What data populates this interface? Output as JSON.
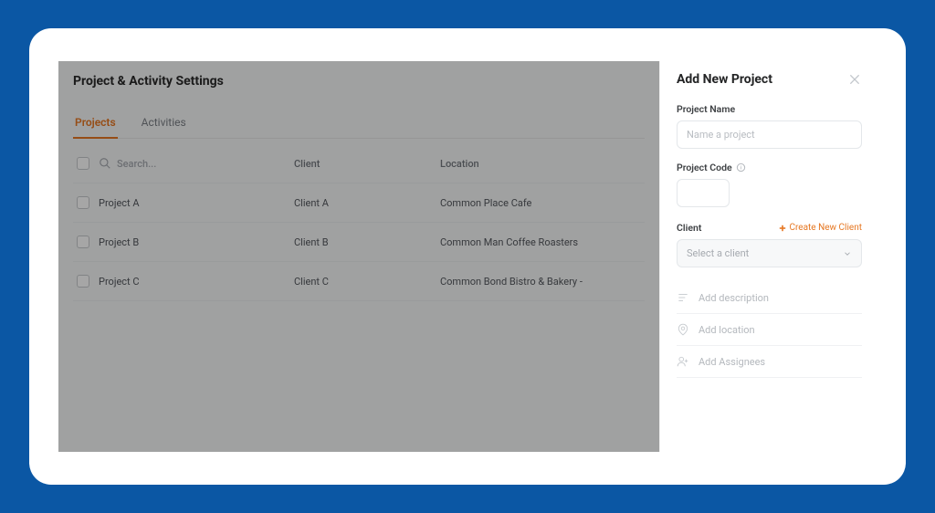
{
  "page": {
    "title": "Project & Activity Settings"
  },
  "tabs": {
    "projects": "Projects",
    "activities": "Activities"
  },
  "table": {
    "search_placeholder": "Search...",
    "col_client": "Client",
    "col_location": "Location",
    "rows": [
      {
        "name": "Project A",
        "client": "Client A",
        "location": "Common Place Cafe"
      },
      {
        "name": "Project B",
        "client": "Client B",
        "location": "Common Man Coffee Roasters"
      },
      {
        "name": "Project C",
        "client": "Client C",
        "location": "Common Bond Bistro & Bakery - "
      }
    ]
  },
  "panel": {
    "title": "Add New Project",
    "project_name_label": "Project Name",
    "project_name_placeholder": "Name a project",
    "project_code_label": "Project Code",
    "client_label": "Client",
    "create_client_label": "Create New Client",
    "select_client_placeholder": "Select a client",
    "add_description": "Add description",
    "add_location": "Add location",
    "add_assignees": "Add Assignees"
  }
}
